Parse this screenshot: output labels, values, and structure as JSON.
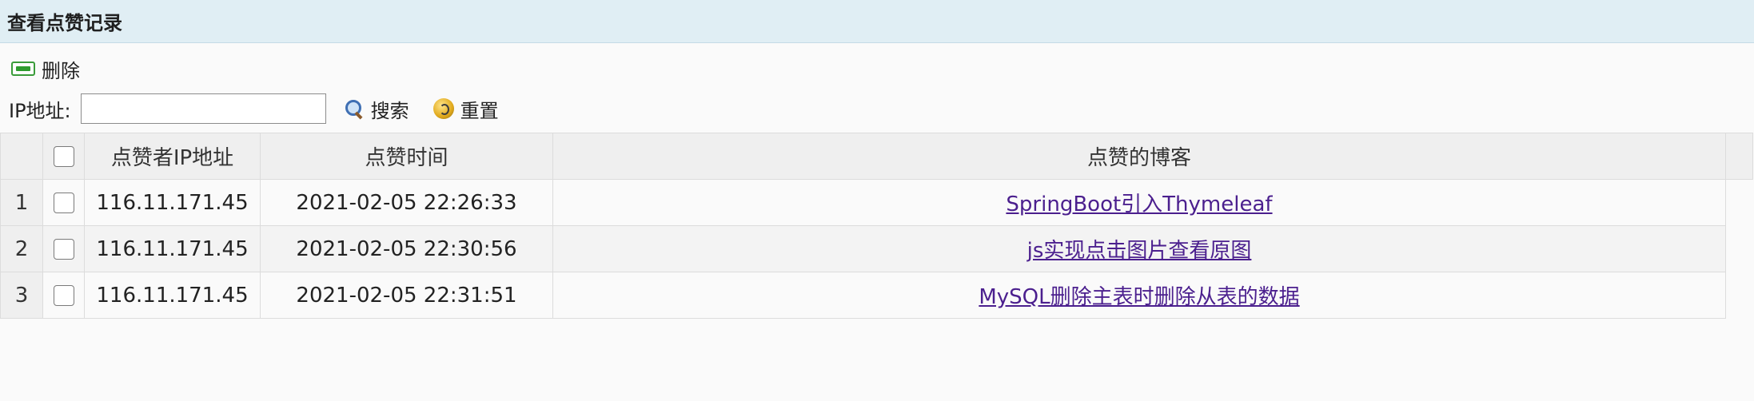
{
  "panel": {
    "title": "查看点赞记录"
  },
  "toolbar": {
    "delete_label": "删除"
  },
  "search": {
    "ip_label": "IP地址:",
    "ip_value": "",
    "search_label": "搜索",
    "reset_label": "重置"
  },
  "table": {
    "columns": [
      "点赞者IP地址",
      "点赞时间",
      "点赞的博客"
    ],
    "rows": [
      {
        "num": "1",
        "ip": "116.11.171.45",
        "time": "2021-02-05 22:26:33",
        "blog": "SpringBoot引入Thymeleaf"
      },
      {
        "num": "2",
        "ip": "116.11.171.45",
        "time": "2021-02-05 22:30:56",
        "blog": "js实现点击图片查看原图"
      },
      {
        "num": "3",
        "ip": "116.11.171.45",
        "time": "2021-02-05 22:31:51",
        "blog": "MySQL删除主表时删除从表的数据"
      }
    ]
  },
  "colors": {
    "header_bg": "#e0eef4",
    "link": "#4b1f8e",
    "delete_icon": "#2e9b2e"
  }
}
